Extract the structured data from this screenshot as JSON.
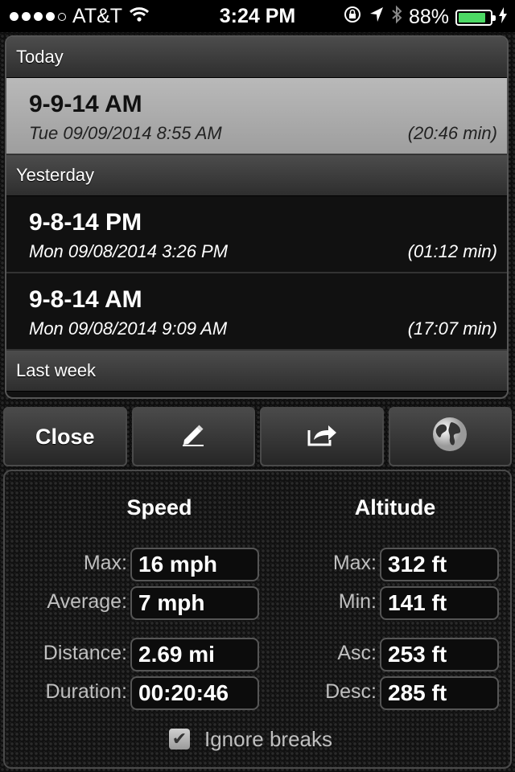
{
  "status_bar": {
    "carrier": "AT&T",
    "time": "3:24 PM",
    "battery": "88%",
    "battery_level": 0.88,
    "signal_bars": 4,
    "signal_max": 5
  },
  "list": {
    "sections": [
      {
        "header": "Today",
        "rows": [
          {
            "title": "9-9-14 AM",
            "date": "Tue 09/09/2014 8:55 AM",
            "duration": "(20:46 min)",
            "selected": true
          }
        ]
      },
      {
        "header": "Yesterday",
        "rows": [
          {
            "title": "9-8-14 PM",
            "date": "Mon 09/08/2014 3:26 PM",
            "duration": "(01:12 min)"
          },
          {
            "title": "9-8-14 AM",
            "date": "Mon 09/08/2014 9:09 AM",
            "duration": "(17:07 min)"
          }
        ]
      },
      {
        "header": "Last week",
        "rows": []
      }
    ]
  },
  "toolbar": {
    "close_label": "Close",
    "icons": [
      "pencil-icon",
      "share-icon",
      "globe-icon"
    ]
  },
  "stats": {
    "speed": {
      "title": "Speed",
      "max_label": "Max:",
      "max_value": "16 mph",
      "avg_label": "Average:",
      "avg_value": "7 mph"
    },
    "altitude": {
      "title": "Altitude",
      "max_label": "Max:",
      "max_value": "312 ft",
      "min_label": "Min:",
      "min_value": "141 ft"
    },
    "distance_label": "Distance:",
    "distance_value": "2.69 mi",
    "duration_label": "Duration:",
    "duration_value": "00:20:46",
    "asc_label": "Asc:",
    "asc_value": "253 ft",
    "desc_label": "Desc:",
    "desc_value": "285 ft",
    "ignore_breaks": {
      "label": "Ignore breaks",
      "checked": true
    }
  },
  "colors": {
    "battery": "#4cd964",
    "selected_row": "#b0b0b0"
  }
}
